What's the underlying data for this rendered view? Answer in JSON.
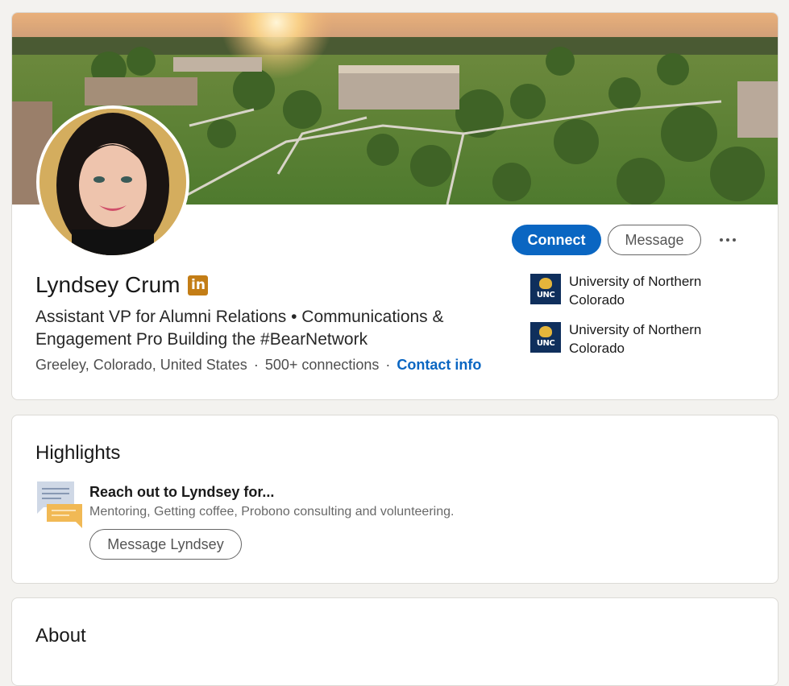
{
  "profile": {
    "name": "Lyndsey Crum",
    "badge": "in",
    "headline": "Assistant VP for Alumni Relations • Communications & Engagement Pro Building the #BearNetwork",
    "location": "Greeley, Colorado, United States",
    "separator": "·",
    "connections": "500+ connections",
    "contact_info": "Contact info"
  },
  "actions": {
    "connect": "Connect",
    "message": "Message"
  },
  "education": [
    {
      "name": "University of Northern Colorado",
      "logo_text": "UNC"
    },
    {
      "name": "University of Northern Colorado",
      "logo_text": "UNC"
    }
  ],
  "highlights": {
    "title": "Highlights",
    "item_title": "Reach out to Lyndsey for...",
    "item_sub": "Mentoring, Getting coffee, Probono consulting and volunteering.",
    "button": "Message Lyndsey"
  },
  "about": {
    "title": "About"
  },
  "colors": {
    "accent": "#0a66c2",
    "background": "#f3f2ef",
    "badge": "#c37d16",
    "unc_navy": "#0f2f5c",
    "unc_gold": "#e4b53b"
  }
}
